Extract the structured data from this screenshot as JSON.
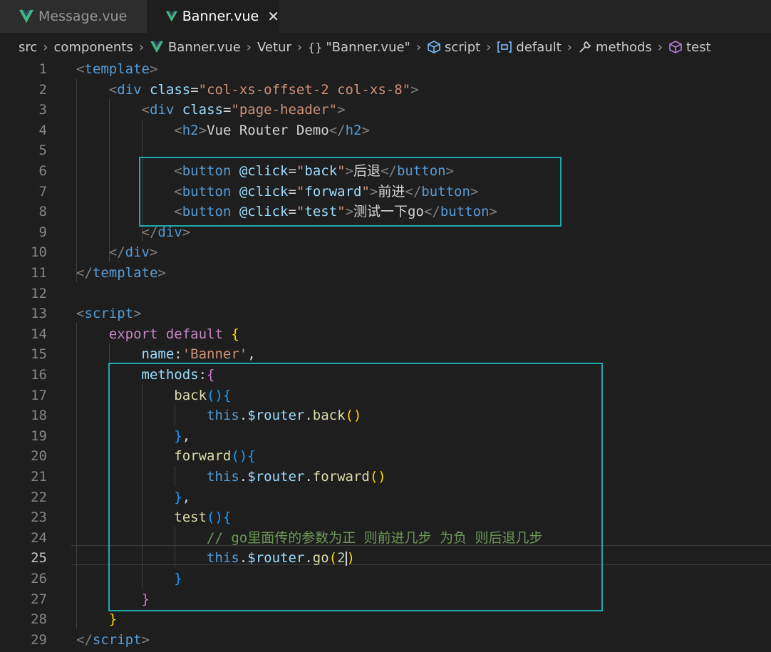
{
  "tabs": [
    {
      "label": "Message.vue",
      "active": false,
      "icon": "vue-icon"
    },
    {
      "label": "Banner.vue",
      "active": true,
      "icon": "vue-icon",
      "close": "✕"
    }
  ],
  "breadcrumb": {
    "src": "src",
    "components": "components",
    "file": "Banner.vue",
    "vetur": "Vetur",
    "module_icon": "{}",
    "module": "\"Banner.vue\"",
    "script": "script",
    "default": "default",
    "methods": "methods",
    "test": "test"
  },
  "editor": {
    "current_line": 25,
    "lines": [
      {
        "n": "1",
        "parts": [
          [
            "t-br",
            "<"
          ],
          [
            "t-tag",
            "template"
          ],
          [
            "t-br",
            ">"
          ]
        ]
      },
      {
        "n": "2",
        "parts": [
          [
            "t-txt",
            "    "
          ],
          [
            "t-br",
            "<"
          ],
          [
            "t-tag",
            "div"
          ],
          [
            "t-txt",
            " "
          ],
          [
            "t-attr",
            "class"
          ],
          [
            "t-txt",
            "="
          ],
          [
            "t-str",
            "\"col-xs-offset-2 col-xs-8\""
          ],
          [
            "t-br",
            ">"
          ]
        ]
      },
      {
        "n": "3",
        "parts": [
          [
            "t-txt",
            "        "
          ],
          [
            "t-br",
            "<"
          ],
          [
            "t-tag",
            "div"
          ],
          [
            "t-txt",
            " "
          ],
          [
            "t-attr",
            "class"
          ],
          [
            "t-txt",
            "="
          ],
          [
            "t-str",
            "\"page-header\""
          ],
          [
            "t-br",
            ">"
          ]
        ]
      },
      {
        "n": "4",
        "parts": [
          [
            "t-txt",
            "            "
          ],
          [
            "t-br",
            "<"
          ],
          [
            "t-tag",
            "h2"
          ],
          [
            "t-br",
            ">"
          ],
          [
            "t-txt",
            "Vue Router Demo"
          ],
          [
            "t-br",
            "</"
          ],
          [
            "t-tag",
            "h2"
          ],
          [
            "t-br",
            ">"
          ]
        ]
      },
      {
        "n": "5",
        "parts": []
      },
      {
        "n": "6",
        "parts": [
          [
            "t-txt",
            "            "
          ],
          [
            "t-br",
            "<"
          ],
          [
            "t-tag",
            "button"
          ],
          [
            "t-txt",
            " "
          ],
          [
            "t-attr",
            "@click"
          ],
          [
            "t-txt",
            "="
          ],
          [
            "t-str",
            "\""
          ],
          [
            "t-var",
            "back"
          ],
          [
            "t-str",
            "\""
          ],
          [
            "t-br",
            ">"
          ],
          [
            "t-txt",
            "后退"
          ],
          [
            "t-br",
            "</"
          ],
          [
            "t-tag",
            "button"
          ],
          [
            "t-br",
            ">"
          ]
        ]
      },
      {
        "n": "7",
        "parts": [
          [
            "t-txt",
            "            "
          ],
          [
            "t-br",
            "<"
          ],
          [
            "t-tag",
            "button"
          ],
          [
            "t-txt",
            " "
          ],
          [
            "t-attr",
            "@click"
          ],
          [
            "t-txt",
            "="
          ],
          [
            "t-str",
            "\""
          ],
          [
            "t-var",
            "forward"
          ],
          [
            "t-str",
            "\""
          ],
          [
            "t-br",
            ">"
          ],
          [
            "t-txt",
            "前进"
          ],
          [
            "t-br",
            "</"
          ],
          [
            "t-tag",
            "button"
          ],
          [
            "t-br",
            ">"
          ]
        ]
      },
      {
        "n": "8",
        "parts": [
          [
            "t-txt",
            "            "
          ],
          [
            "t-br",
            "<"
          ],
          [
            "t-tag",
            "button"
          ],
          [
            "t-txt",
            " "
          ],
          [
            "t-attr",
            "@click"
          ],
          [
            "t-txt",
            "="
          ],
          [
            "t-str",
            "\""
          ],
          [
            "t-var",
            "test"
          ],
          [
            "t-str",
            "\""
          ],
          [
            "t-br",
            ">"
          ],
          [
            "t-txt",
            "测试一下go"
          ],
          [
            "t-br",
            "</"
          ],
          [
            "t-tag",
            "button"
          ],
          [
            "t-br",
            ">"
          ]
        ]
      },
      {
        "n": "9",
        "parts": [
          [
            "t-txt",
            "        "
          ],
          [
            "t-br",
            "</"
          ],
          [
            "t-tag",
            "div"
          ],
          [
            "t-br",
            ">"
          ]
        ]
      },
      {
        "n": "10",
        "parts": [
          [
            "t-txt",
            "    "
          ],
          [
            "t-br",
            "</"
          ],
          [
            "t-tag",
            "div"
          ],
          [
            "t-br",
            ">"
          ]
        ]
      },
      {
        "n": "11",
        "parts": [
          [
            "t-br",
            "</"
          ],
          [
            "t-tag",
            "template"
          ],
          [
            "t-br",
            ">"
          ]
        ]
      },
      {
        "n": "12",
        "parts": []
      },
      {
        "n": "13",
        "parts": [
          [
            "t-br",
            "<"
          ],
          [
            "t-tag",
            "script"
          ],
          [
            "t-br",
            ">"
          ]
        ]
      },
      {
        "n": "14",
        "parts": [
          [
            "t-txt",
            "    "
          ],
          [
            "t-kw",
            "export"
          ],
          [
            "t-txt",
            " "
          ],
          [
            "t-kw",
            "default"
          ],
          [
            "t-txt",
            " "
          ],
          [
            "t-p1",
            "{"
          ]
        ]
      },
      {
        "n": "15",
        "parts": [
          [
            "t-txt",
            "        "
          ],
          [
            "t-var",
            "name"
          ],
          [
            "t-txt",
            ":"
          ],
          [
            "t-str",
            "'Banner'"
          ],
          [
            "t-txt",
            ","
          ]
        ]
      },
      {
        "n": "16",
        "parts": [
          [
            "t-txt",
            "        "
          ],
          [
            "t-var",
            "methods"
          ],
          [
            "t-txt",
            ":"
          ],
          [
            "t-p2",
            "{"
          ]
        ]
      },
      {
        "n": "17",
        "parts": [
          [
            "t-txt",
            "            "
          ],
          [
            "t-fn",
            "back"
          ],
          [
            "t-p3",
            "()"
          ],
          [
            "t-p3",
            "{"
          ]
        ]
      },
      {
        "n": "18",
        "parts": [
          [
            "t-txt",
            "                "
          ],
          [
            "t-this",
            "this"
          ],
          [
            "t-txt",
            "."
          ],
          [
            "t-var",
            "$router"
          ],
          [
            "t-txt",
            "."
          ],
          [
            "t-fn",
            "back"
          ],
          [
            "t-p1",
            "()"
          ]
        ]
      },
      {
        "n": "19",
        "parts": [
          [
            "t-txt",
            "            "
          ],
          [
            "t-p3",
            "}"
          ],
          [
            "t-txt",
            ","
          ]
        ]
      },
      {
        "n": "20",
        "parts": [
          [
            "t-txt",
            "            "
          ],
          [
            "t-fn",
            "forward"
          ],
          [
            "t-p3",
            "()"
          ],
          [
            "t-p3",
            "{"
          ]
        ]
      },
      {
        "n": "21",
        "parts": [
          [
            "t-txt",
            "                "
          ],
          [
            "t-this",
            "this"
          ],
          [
            "t-txt",
            "."
          ],
          [
            "t-var",
            "$router"
          ],
          [
            "t-txt",
            "."
          ],
          [
            "t-fn",
            "forward"
          ],
          [
            "t-p1",
            "()"
          ]
        ]
      },
      {
        "n": "22",
        "parts": [
          [
            "t-txt",
            "            "
          ],
          [
            "t-p3",
            "}"
          ],
          [
            "t-txt",
            ","
          ]
        ]
      },
      {
        "n": "23",
        "parts": [
          [
            "t-txt",
            "            "
          ],
          [
            "t-fn",
            "test"
          ],
          [
            "t-p3",
            "()"
          ],
          [
            "t-p3",
            "{"
          ]
        ]
      },
      {
        "n": "24",
        "parts": [
          [
            "t-txt",
            "                "
          ],
          [
            "t-cm",
            "// go里面传的参数为正 则前进几步 为负 则后退几步"
          ]
        ]
      },
      {
        "n": "25",
        "parts": [
          [
            "t-txt",
            "                "
          ],
          [
            "t-this",
            "this"
          ],
          [
            "t-txt",
            "."
          ],
          [
            "t-var",
            "$router"
          ],
          [
            "t-txt",
            "."
          ],
          [
            "t-fn",
            "go"
          ],
          [
            "t-p1",
            "("
          ],
          [
            "t-num",
            "2"
          ],
          [
            "cursor",
            ""
          ],
          [
            "t-p1",
            ")"
          ]
        ]
      },
      {
        "n": "26",
        "parts": [
          [
            "t-txt",
            "            "
          ],
          [
            "t-p3",
            "}"
          ]
        ]
      },
      {
        "n": "27",
        "parts": [
          [
            "t-txt",
            "        "
          ],
          [
            "t-p2",
            "}"
          ]
        ]
      },
      {
        "n": "28",
        "parts": [
          [
            "t-txt",
            "    "
          ],
          [
            "t-p1",
            "}"
          ]
        ]
      },
      {
        "n": "29",
        "parts": [
          [
            "t-br",
            "</"
          ],
          [
            "t-tag",
            "script"
          ],
          [
            "t-br",
            ">"
          ]
        ]
      }
    ]
  }
}
